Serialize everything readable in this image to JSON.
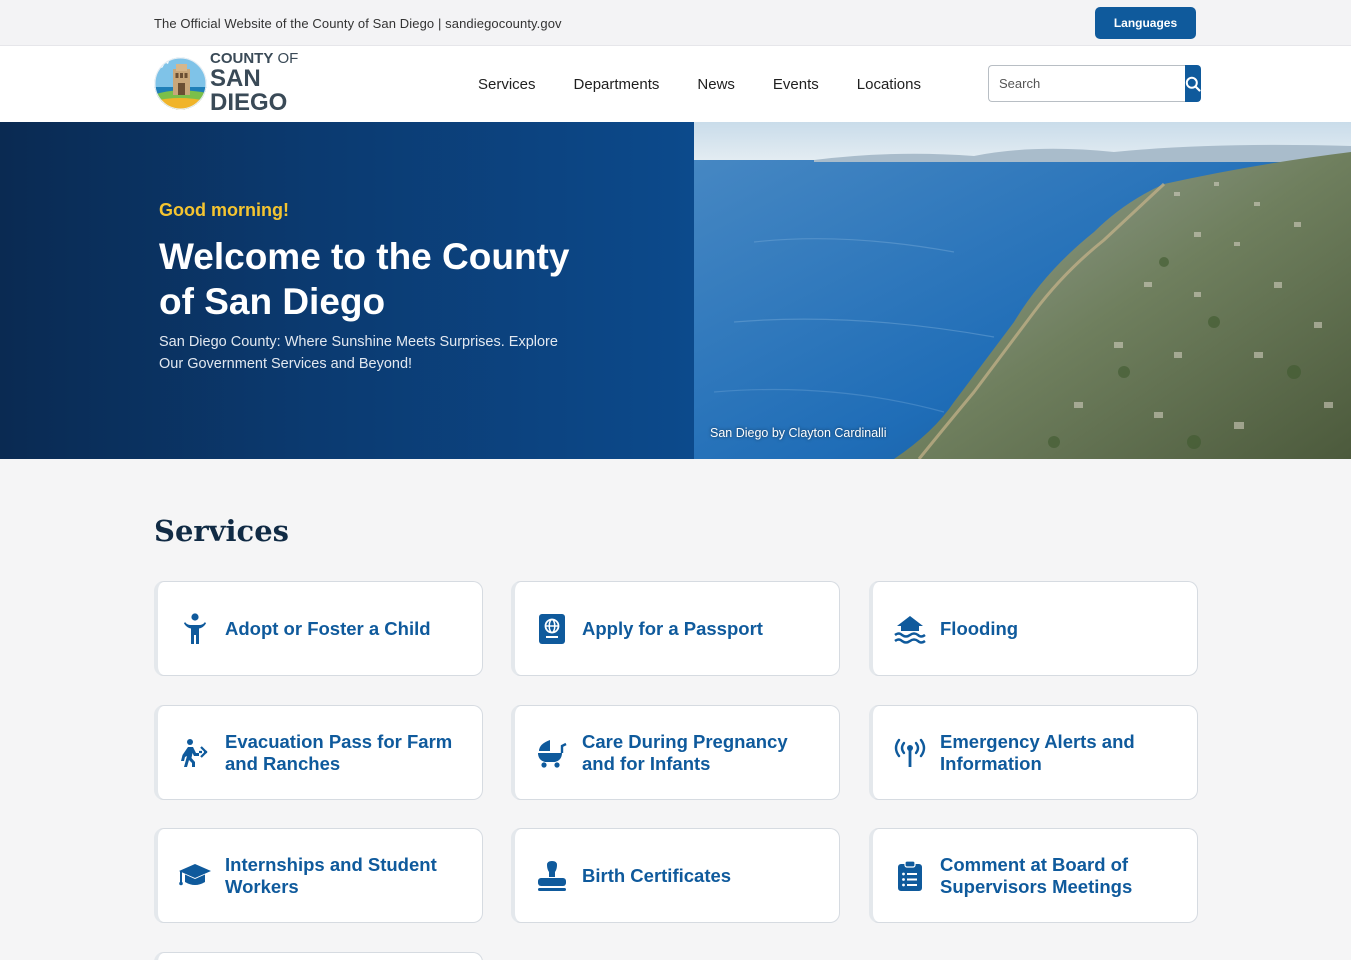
{
  "utility": {
    "official_text": "The Official Website of the County of San Diego | sandiegocounty.gov",
    "languages_label": "Languages"
  },
  "header": {
    "logo_line1_a": "COUNTY",
    "logo_line1_b": " OF",
    "logo_line2": "SAN DIEGO",
    "nav": [
      "Services",
      "Departments",
      "News",
      "Events",
      "Locations"
    ],
    "search_placeholder": "Search"
  },
  "hero": {
    "greeting": "Good morning!",
    "title": "Welcome to the County of San Diego",
    "subtitle": "San Diego County: Where Sunshine Meets Surprises. Explore Our Government Services and Beyond!",
    "photo_credit": "San Diego by Clayton Cardinalli"
  },
  "services": {
    "title": "Services",
    "items": [
      {
        "label": "Adopt or Foster a Child",
        "icon": "child-icon"
      },
      {
        "label": "Apply for a Passport",
        "icon": "passport-icon"
      },
      {
        "label": "Flooding",
        "icon": "flood-icon"
      },
      {
        "label": "Evacuation Pass for Farm and Ranches",
        "icon": "evacuation-icon"
      },
      {
        "label": "Care During Pregnancy and for Infants",
        "icon": "baby-carriage-icon"
      },
      {
        "label": "Emergency Alerts and Information",
        "icon": "broadcast-tower-icon"
      },
      {
        "label": "Internships and Student Workers",
        "icon": "graduation-cap-icon"
      },
      {
        "label": "Birth Certificates",
        "icon": "stamp-icon"
      },
      {
        "label": "Comment at Board of Supervisors Meetings",
        "icon": "clipboard-list-icon"
      }
    ]
  },
  "colors": {
    "brand_blue": "#0f5a9c",
    "hero_navy": "#0a2a52",
    "greeting_gold": "#f4c430",
    "title_navy": "#112b45"
  }
}
